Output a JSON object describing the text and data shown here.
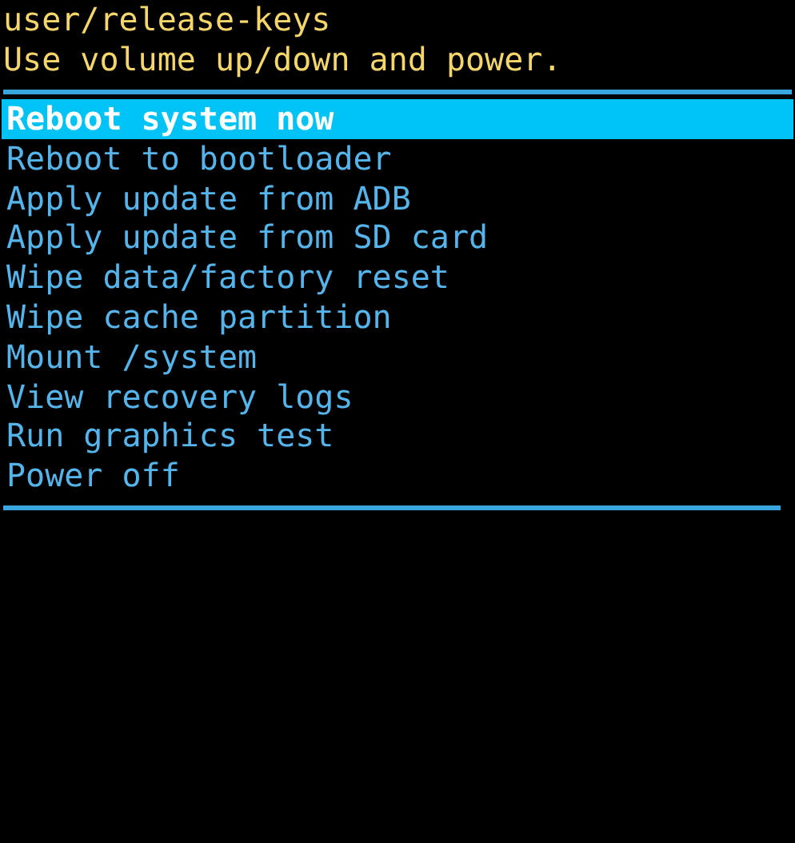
{
  "header": [
    "user/release-keys",
    "Use volume up/down and power."
  ],
  "menu": [
    {
      "label": "Reboot system now",
      "selected": true
    },
    {
      "label": "Reboot to bootloader",
      "selected": false
    },
    {
      "label": "Apply update from ADB",
      "selected": false
    },
    {
      "label": "Apply update from SD card",
      "selected": false
    },
    {
      "label": "Wipe data/factory reset",
      "selected": false
    },
    {
      "label": "Wipe cache partition",
      "selected": false
    },
    {
      "label": "Mount /system",
      "selected": false
    },
    {
      "label": "View recovery logs",
      "selected": false
    },
    {
      "label": "Run graphics test",
      "selected": false
    },
    {
      "label": "Power off",
      "selected": false
    }
  ]
}
